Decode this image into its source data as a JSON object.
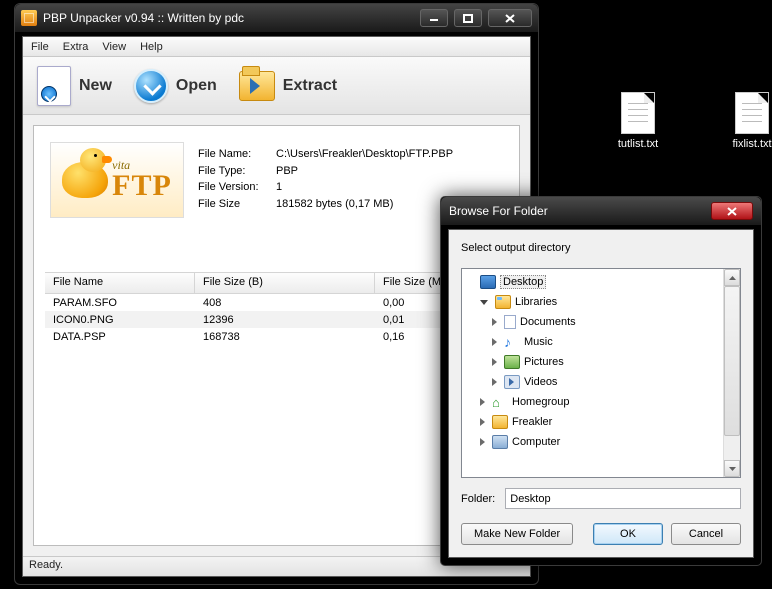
{
  "desktop_files": {
    "f0": "tutlist.txt",
    "f1": "fixlist.txt"
  },
  "window": {
    "title": "PBP Unpacker v0.94 :: Written by pdc",
    "status": "Ready."
  },
  "menu": {
    "file": "File",
    "extra": "Extra",
    "view": "View",
    "help": "Help"
  },
  "toolbar": {
    "new_": "New",
    "open": "Open",
    "extract": "Extract"
  },
  "thumb": {
    "vita": "vita",
    "ftp": "FTP"
  },
  "info": {
    "k_name": "File Name:",
    "v_name": "C:\\Users\\Freakler\\Desktop\\FTP.PBP",
    "k_type": "File Type:",
    "v_type": "PBP",
    "k_ver": "File Version:",
    "v_ver": "1",
    "k_size": "File Size",
    "v_size": "181582 bytes (0,17 MB)"
  },
  "list": {
    "h_name": "File Name",
    "h_b": "File Size (B)",
    "h_mb": "File Size (MB)",
    "rows": [
      {
        "name": "PARAM.SFO",
        "b": "408",
        "mb": "0,00"
      },
      {
        "name": "ICON0.PNG",
        "b": "12396",
        "mb": "0,01"
      },
      {
        "name": "DATA.PSP",
        "b": "168738",
        "mb": "0,16"
      }
    ]
  },
  "dialog": {
    "title": "Browse For Folder",
    "msg": "Select output directory",
    "tree": {
      "desktop": "Desktop",
      "libraries": "Libraries",
      "documents": "Documents",
      "music": "Music",
      "pictures": "Pictures",
      "videos": "Videos",
      "homegroup": "Homegroup",
      "freakler": "Freakler",
      "computer": "Computer"
    },
    "folder_label": "Folder:",
    "folder_value": "Desktop",
    "make_new": "Make New Folder",
    "ok": "OK",
    "cancel": "Cancel"
  }
}
